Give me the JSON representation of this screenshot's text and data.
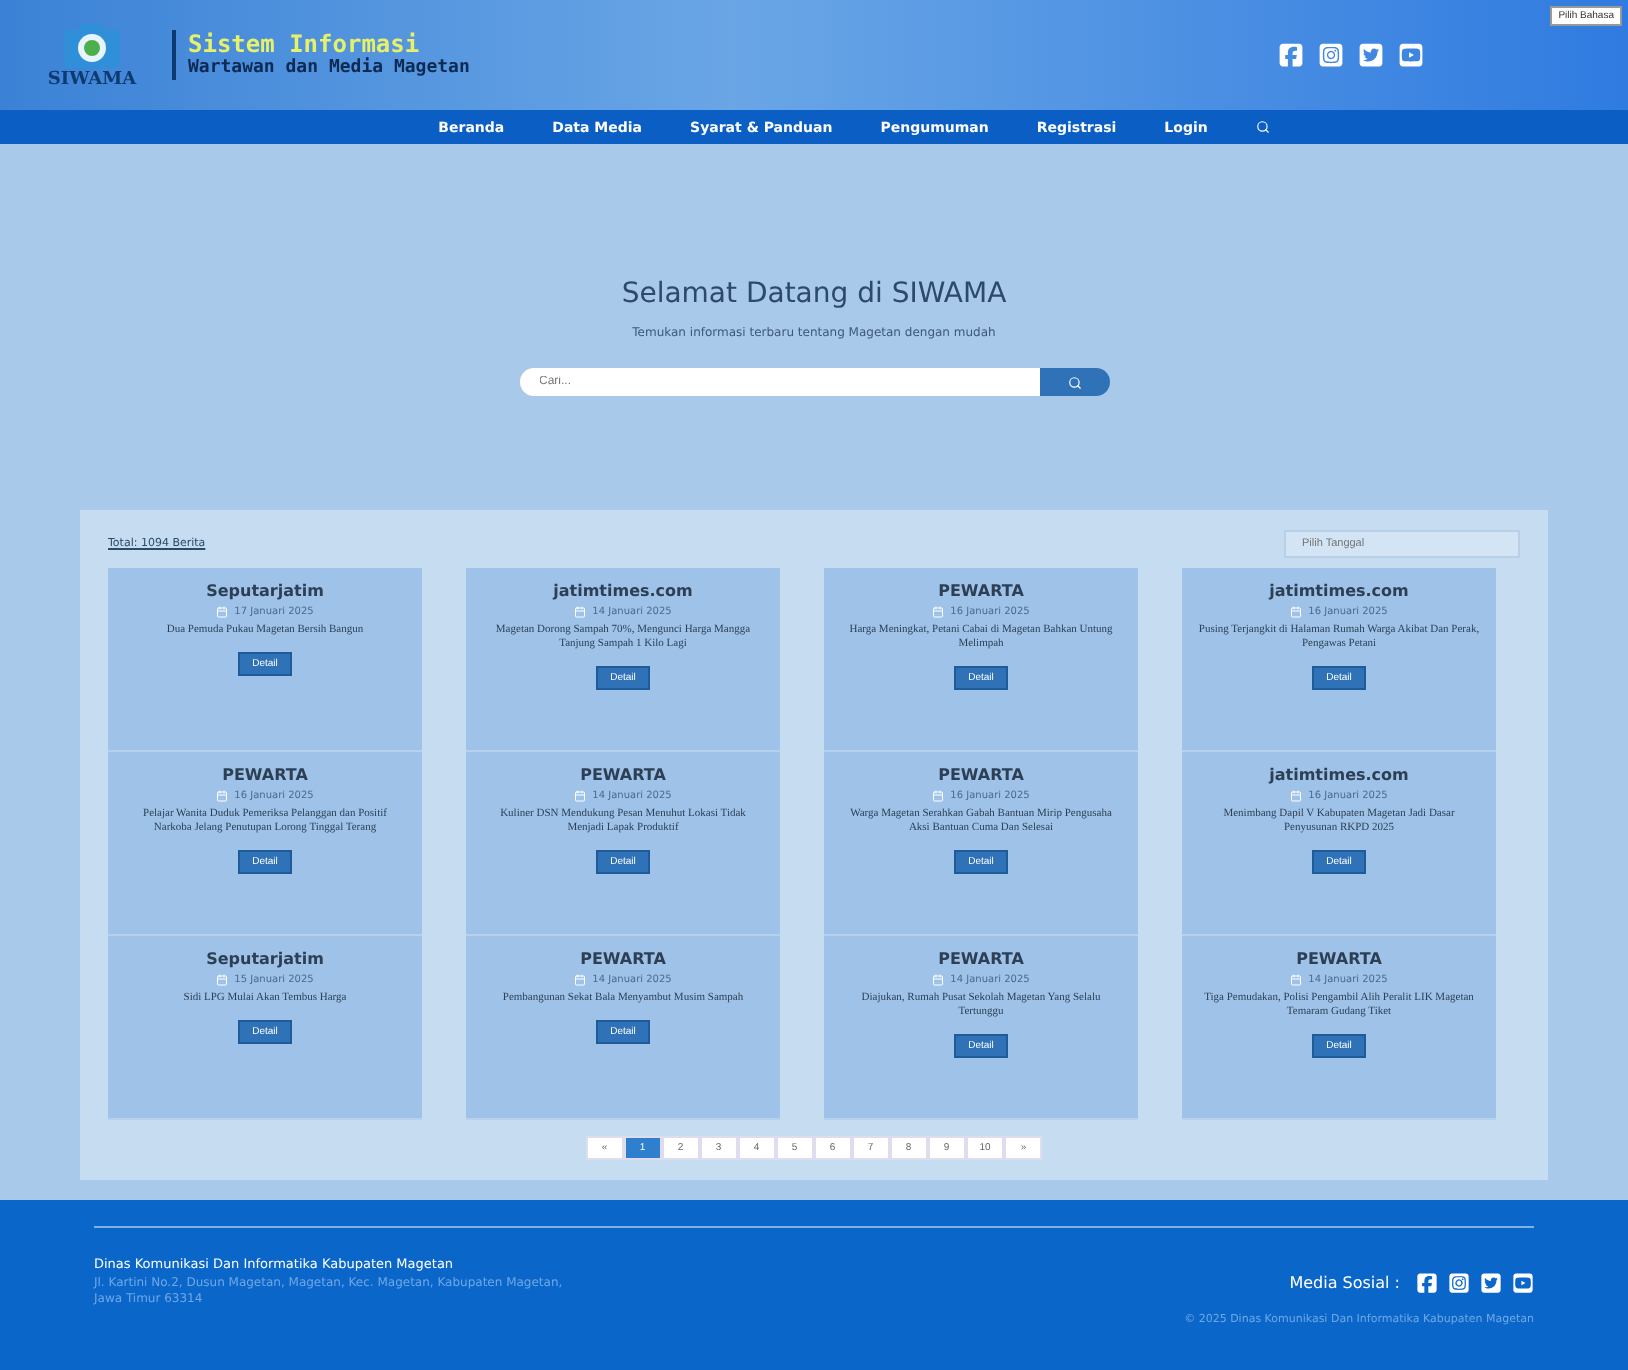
{
  "language_button": "Pilih Bahasa",
  "logo": {
    "caption": "SIWAMA"
  },
  "site_title": {
    "line1": "Sistem Informasi",
    "line2": "Wartawan dan Media Magetan"
  },
  "nav": [
    {
      "label": "Beranda",
      "selected": false
    },
    {
      "label": "Data Media",
      "selected": false
    },
    {
      "label": "Syarat & Panduan",
      "selected": false
    },
    {
      "label": "Pengumuman",
      "selected": false
    },
    {
      "label": "Registrasi",
      "selected": false
    },
    {
      "label": "Login",
      "selected": false
    }
  ],
  "hero": {
    "title": "Selamat Datang di SIWAMA",
    "subtitle": "Temukan informasi terbaru tentang Magetan dengan mudah",
    "search_placeholder": "Cari..."
  },
  "news": {
    "total": "Total: 1094 Berita",
    "date_filter_placeholder": "Pilih Tanggal",
    "cards": [
      {
        "source": "Seputarjatim",
        "date": "17 Januari 2025",
        "headline": "Dua Pemuda Pukau Magetan Bersih Bangun",
        "button": "Detail"
      },
      {
        "source": "jatimtimes.com",
        "date": "14 Januari 2025",
        "headline": "Magetan Dorong Sampah 70%, Mengunci Harga Mangga Tanjung Sampah 1 Kilo Lagi",
        "button": "Detail"
      },
      {
        "source": "PEWARTA",
        "date": "16 Januari 2025",
        "headline": "Harga Meningkat, Petani Cabai di Magetan Bahkan Untung Melimpah",
        "button": "Detail"
      },
      {
        "source": "jatimtimes.com",
        "date": "16 Januari 2025",
        "headline": "Pusing Terjangkit di Halaman Rumah Warga Akibat Dan Perak, Pengawas Petani",
        "button": "Detail"
      },
      {
        "source": "PEWARTA",
        "date": "16 Januari 2025",
        "headline": "Pelajar Wanita Duduk Pemeriksa Pelanggan dan Positif Narkoba Jelang Penutupan Lorong Tinggal Terang",
        "button": "Detail"
      },
      {
        "source": "PEWARTA",
        "date": "14 Januari 2025",
        "headline": "Kuliner DSN Mendukung Pesan Menuhut Lokasi Tidak Menjadi Lapak Produktif",
        "button": "Detail"
      },
      {
        "source": "PEWARTA",
        "date": "16 Januari 2025",
        "headline": "Warga Magetan Serahkan Gabah Bantuan Mirip Pengusaha Aksi Bantuan Cuma Dan Selesai",
        "button": "Detail"
      },
      {
        "source": "jatimtimes.com",
        "date": "16 Januari 2025",
        "headline": "Menimbang Dapil V Kabupaten Magetan Jadi Dasar Penyusunan RKPD 2025",
        "button": "Detail"
      },
      {
        "source": "Seputarjatim",
        "date": "15 Januari 2025",
        "headline": "Sidi LPG Mulai Akan Tembus Harga",
        "button": "Detail"
      },
      {
        "source": "PEWARTA",
        "date": "14 Januari 2025",
        "headline": "Pembangunan Sekat Bala Menyambut Musim Sampah",
        "button": "Detail"
      },
      {
        "source": "PEWARTA",
        "date": "14 Januari 2025",
        "headline": "Diajukan, Rumah Pusat Sekolah Magetan Yang Selalu Tertunggu",
        "button": "Detail"
      },
      {
        "source": "PEWARTA",
        "date": "14 Januari 2025",
        "headline": "Tiga Pemudakan, Polisi Pengambil Alih Peralit LIK Magetan Temaram Gudang Tiket",
        "button": "Detail"
      }
    ],
    "pagination": [
      {
        "label": "«",
        "selected": false
      },
      {
        "label": "1",
        "selected": true
      },
      {
        "label": "2",
        "selected": false
      },
      {
        "label": "3",
        "selected": false
      },
      {
        "label": "4",
        "selected": false
      },
      {
        "label": "5",
        "selected": false
      },
      {
        "label": "6",
        "selected": false
      },
      {
        "label": "7",
        "selected": false
      },
      {
        "label": "8",
        "selected": false
      },
      {
        "label": "9",
        "selected": false
      },
      {
        "label": "10",
        "selected": false
      },
      {
        "label": "»",
        "selected": false
      }
    ]
  },
  "footer": {
    "org": "Dinas Komunikasi Dan Informatika Kabupaten Magetan",
    "address": "Jl. Kartini No.2, Dusun Magetan, Magetan, Kec. Magetan, Kabupaten Magetan, Jawa Timur 63314",
    "social_label": "Media Sosial :",
    "copyright": "© 2025 Dinas Komunikasi Dan Informatika Kabupaten Magetan"
  }
}
